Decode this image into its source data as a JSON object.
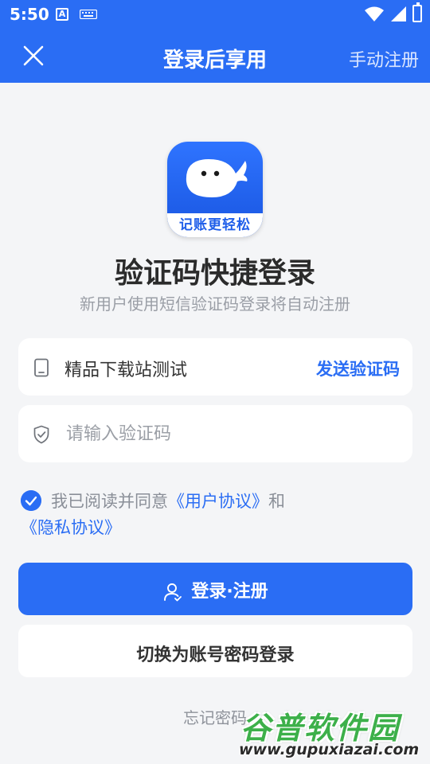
{
  "status_bar": {
    "time": "5:50",
    "a_icon": "A"
  },
  "header": {
    "title": "登录后享用",
    "register_label": "手动注册"
  },
  "logo": {
    "text": "记账更轻松"
  },
  "main": {
    "heading": "验证码快捷登录",
    "subheading": "新用户使用短信验证码登录将自动注册"
  },
  "phone_field": {
    "value": "精品下载站测试",
    "send_code_label": "发送验证码"
  },
  "code_field": {
    "placeholder": "请输入验证码"
  },
  "agreement": {
    "checked": true,
    "prefix": "我已阅读并同意",
    "user_agreement": "《用户协议》",
    "conjunction": "和",
    "privacy_agreement": "《隐私协议》"
  },
  "buttons": {
    "login_register": "登录·注册",
    "switch_password": "切换为账号密码登录"
  },
  "forgot_password": "忘记密码",
  "watermark": {
    "main": "谷普软件园",
    "url": "www.gupuxiazai.com"
  },
  "colors": {
    "accent": "#2a6df4",
    "background": "#f4f5f7"
  }
}
